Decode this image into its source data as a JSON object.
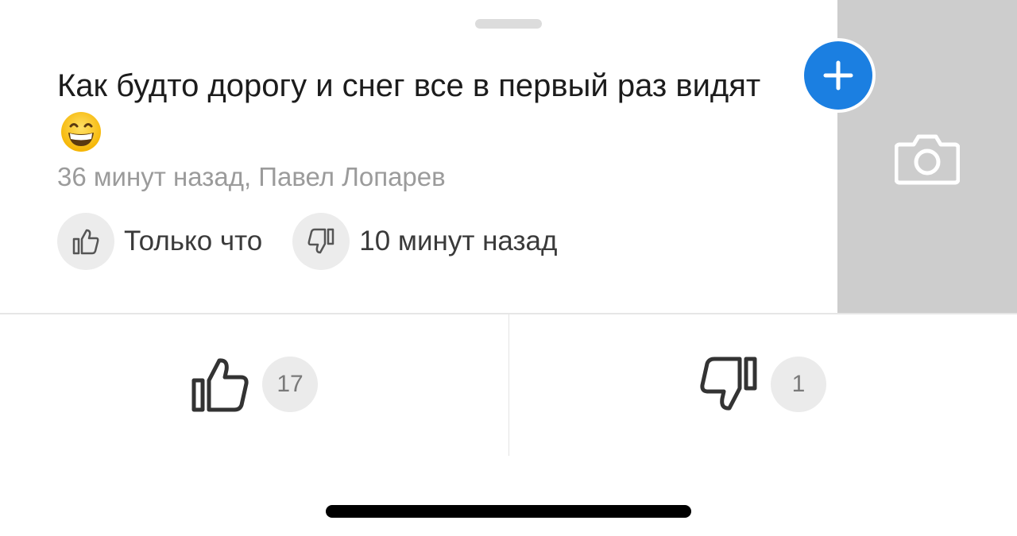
{
  "post": {
    "text": "Как будто дорогу и снег все в первый раз видят",
    "emoji": "😁",
    "meta": "36 минут назад, Павел Лопарев"
  },
  "reactions": {
    "like_time": "Только что",
    "dislike_time": "10 минут назад"
  },
  "votes": {
    "likes": "17",
    "dislikes": "1"
  },
  "icons": {
    "add": "plus-icon",
    "camera": "camera-icon",
    "like": "thumbs-up-icon",
    "dislike": "thumbs-down-icon"
  },
  "colors": {
    "accent": "#1b7fe1",
    "side_panel": "#cdcdcd",
    "meta_text": "#9b9b9b",
    "badge_bg": "#ebebeb"
  }
}
